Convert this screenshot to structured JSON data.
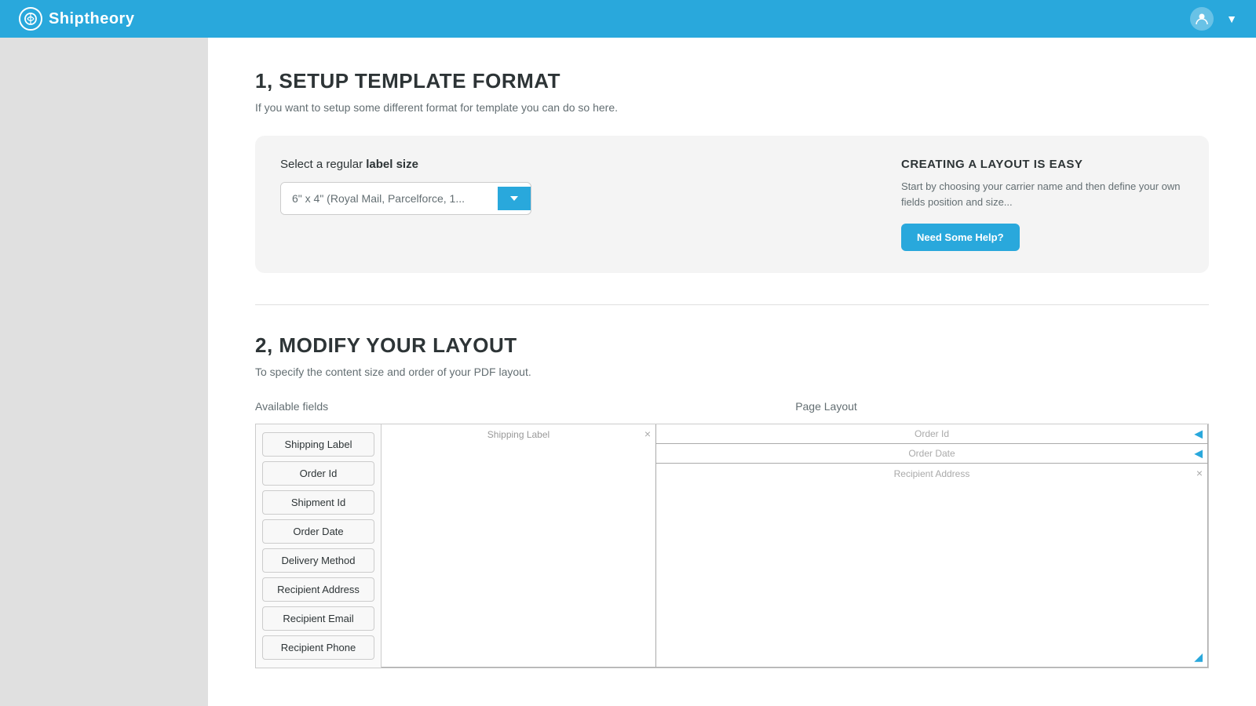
{
  "header": {
    "logo_text": "Shiptheory",
    "user_dropdown_label": "▼"
  },
  "section1": {
    "title": "1, SETUP TEMPLATE FORMAT",
    "subtitle": "If you want to setup some different format for template you can do so here.",
    "select_label_prefix": "Select a regular ",
    "select_label_bold": "label size",
    "select_value": "6\" x 4\" (Royal Mail, Parcelforce, 1...",
    "creating_title": "CREATING A LAYOUT IS EASY",
    "creating_desc": "Start by choosing your carrier name and then define your own fields position and size...",
    "help_btn": "Need Some Help?"
  },
  "section2": {
    "title": "2, MODIFY YOUR LAYOUT",
    "subtitle": "To specify the content size and order of your PDF layout.",
    "available_fields_label": "Available fields",
    "page_layout_label": "Page Layout",
    "available_fields": [
      "Shipping Label",
      "Order Id",
      "Shipment Id",
      "Order Date",
      "Delivery Method",
      "Recipient Address",
      "Recipient Email",
      "Recipient Phone"
    ],
    "page_shipping_label": "Shipping Label",
    "page_fields": [
      {
        "label": "Order Id",
        "type": "row"
      },
      {
        "label": "Order Date",
        "type": "row"
      },
      {
        "label": "Recipient Address",
        "type": "address"
      }
    ]
  }
}
